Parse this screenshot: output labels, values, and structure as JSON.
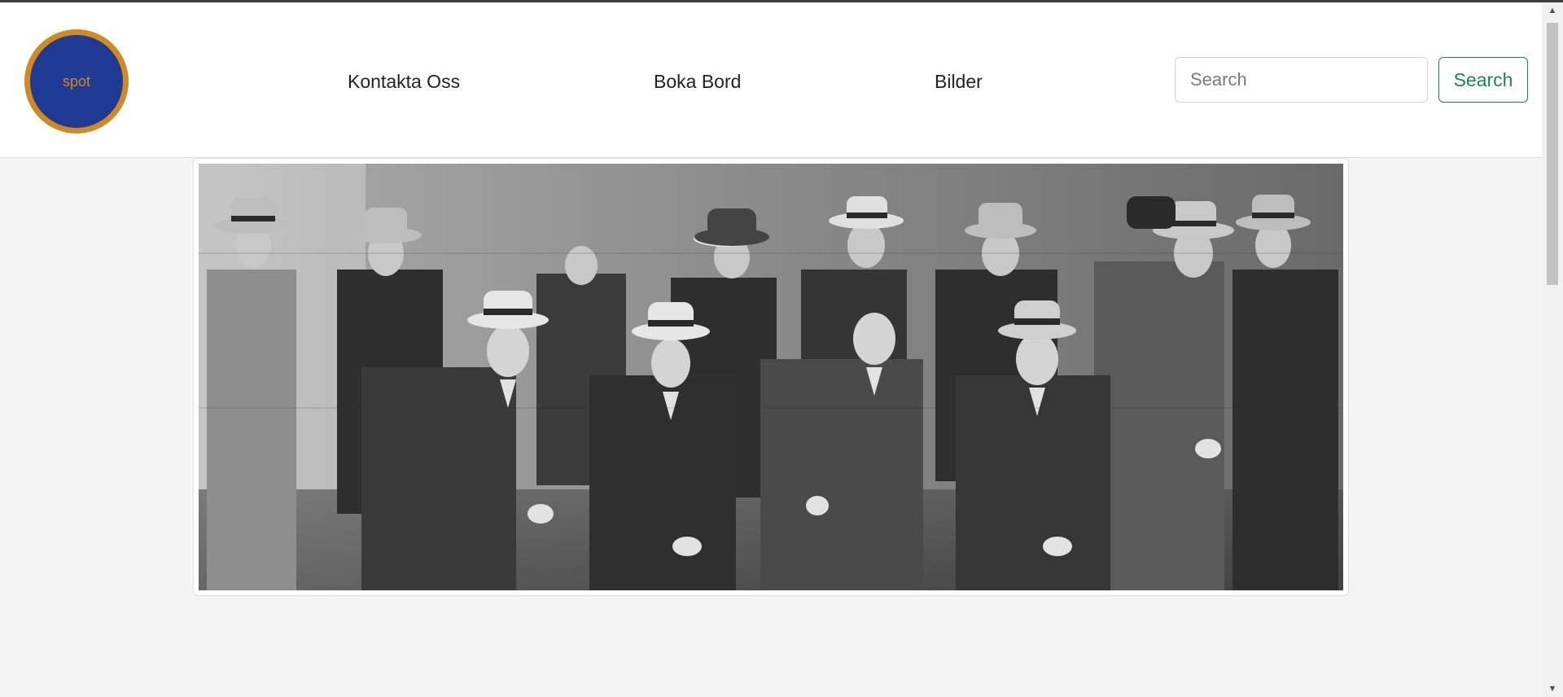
{
  "logo": {
    "text": "spot"
  },
  "nav": {
    "links": [
      {
        "label": "Kontakta Oss"
      },
      {
        "label": "Boka Bord"
      },
      {
        "label": "Bilder"
      }
    ]
  },
  "search": {
    "placeholder": "Search",
    "value": "",
    "button_label": "Search"
  },
  "colors": {
    "logo_fill": "#1f3a93",
    "logo_ring": "#cf8a22",
    "search_button": "#198754",
    "page_background": "#f4f4f4"
  },
  "hero": {
    "image": "black-and-white-group-photo"
  }
}
